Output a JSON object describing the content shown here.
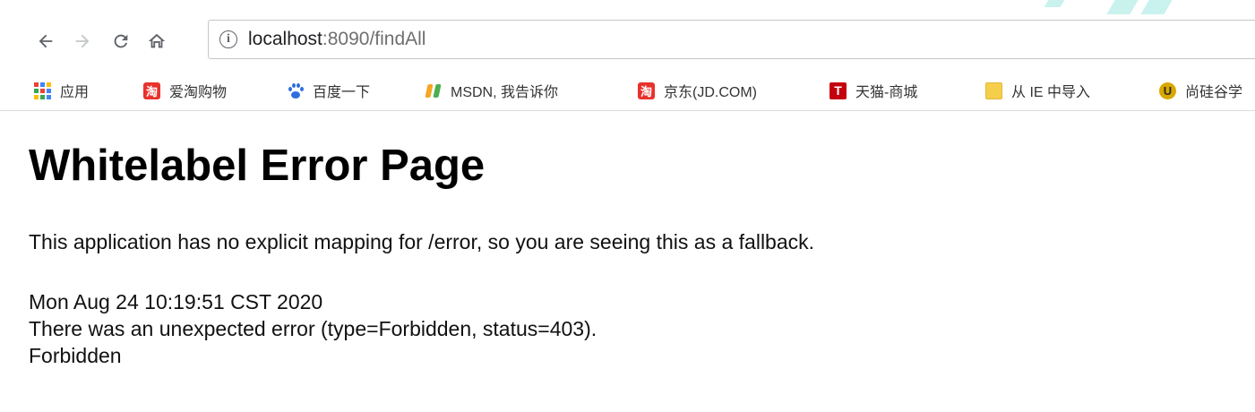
{
  "browser": {
    "url_host": "localhost",
    "url_rest": ":8090/findAll",
    "nav_icons": [
      "back-icon",
      "forward-icon",
      "reload-icon",
      "home-icon"
    ]
  },
  "bookmarks": [
    {
      "label": "应用",
      "icon": "apps-grid-icon"
    },
    {
      "label": "爱淘购物",
      "icon": "taobao-icon",
      "icon_text": "淘"
    },
    {
      "label": "百度一下",
      "icon": "baidu-paw-icon"
    },
    {
      "label": "MSDN, 我告诉你",
      "icon": "msdn-icon"
    },
    {
      "label": "京东(JD.COM)",
      "icon": "taobao-icon",
      "icon_text": "淘"
    },
    {
      "label": "天猫-商城",
      "icon": "tmall-icon",
      "icon_text": "T"
    },
    {
      "label": "从 IE 中导入",
      "icon": "folder-icon"
    },
    {
      "label": "尚硅谷学",
      "icon": "sgg-icon",
      "icon_text": "U"
    }
  ],
  "content": {
    "title": "Whitelabel Error Page",
    "description": "This application has no explicit mapping for /error, so you are seeing this as a fallback.",
    "timestamp": "Mon Aug 24 10:19:51 CST 2020",
    "error_line": "There was an unexpected error (type=Forbidden, status=403).",
    "message": "Forbidden"
  },
  "colors": {
    "tab_icon_gray": "#5f6368",
    "disabled_icon": "#c4c7ca",
    "taobao_red": "#e8322c",
    "tmall_red": "#c4000f",
    "baidu_blue": "#2f6fde",
    "folder_yellow": "#f5cf4b"
  }
}
